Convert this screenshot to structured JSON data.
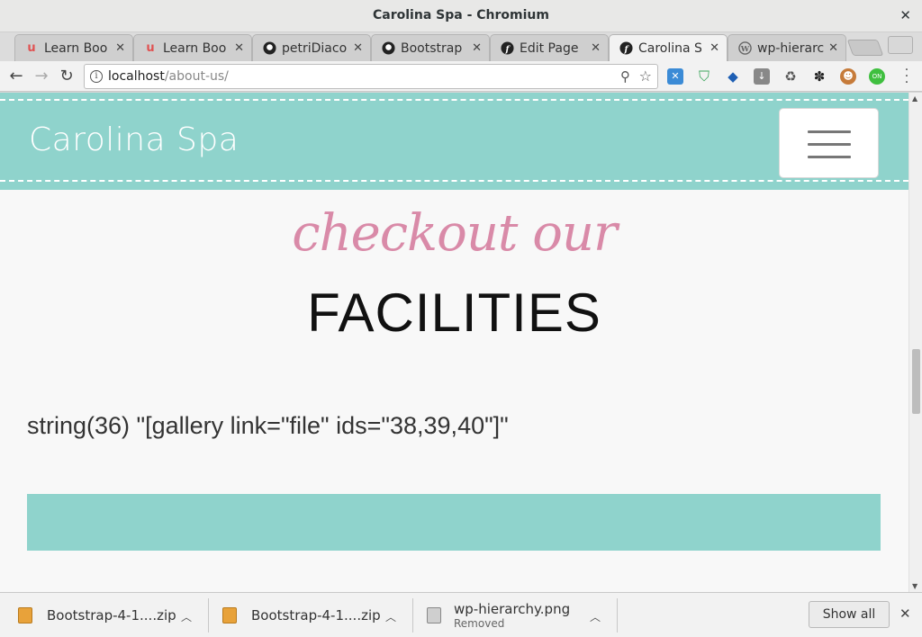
{
  "window": {
    "title": "Carolina Spa - Chromium"
  },
  "tabs": [
    {
      "label": "Learn Boo",
      "icon": "udemy-icon"
    },
    {
      "label": "Learn Boo",
      "icon": "udemy-icon"
    },
    {
      "label": "petriDiaco",
      "icon": "github-icon"
    },
    {
      "label": "Bootstrap",
      "icon": "github-icon"
    },
    {
      "label": "Edit Page",
      "icon": "symfony-icon"
    },
    {
      "label": "Carolina S",
      "icon": "symfony-icon",
      "active": true
    },
    {
      "label": "wp-hierarc",
      "icon": "wordpress-icon"
    }
  ],
  "address": {
    "host": "localhost",
    "path": "/about-us/"
  },
  "page": {
    "brand": "Carolina Spa",
    "script_heading": "checkout our",
    "heading": "FACILITIES",
    "dump_text": "string(36) \"[gallery link=\"file\" ids=\"38,39,40\"]\""
  },
  "downloads": [
    {
      "name": "Bootstrap-4-1....zip",
      "status": ""
    },
    {
      "name": "Bootstrap-4-1....zip",
      "status": ""
    },
    {
      "name": "wp-hierarchy.png",
      "status": "Removed"
    }
  ],
  "download_bar": {
    "show_all": "Show all"
  },
  "colors": {
    "accent": "#8fd3cc",
    "script_pink": "#d98aa8"
  }
}
